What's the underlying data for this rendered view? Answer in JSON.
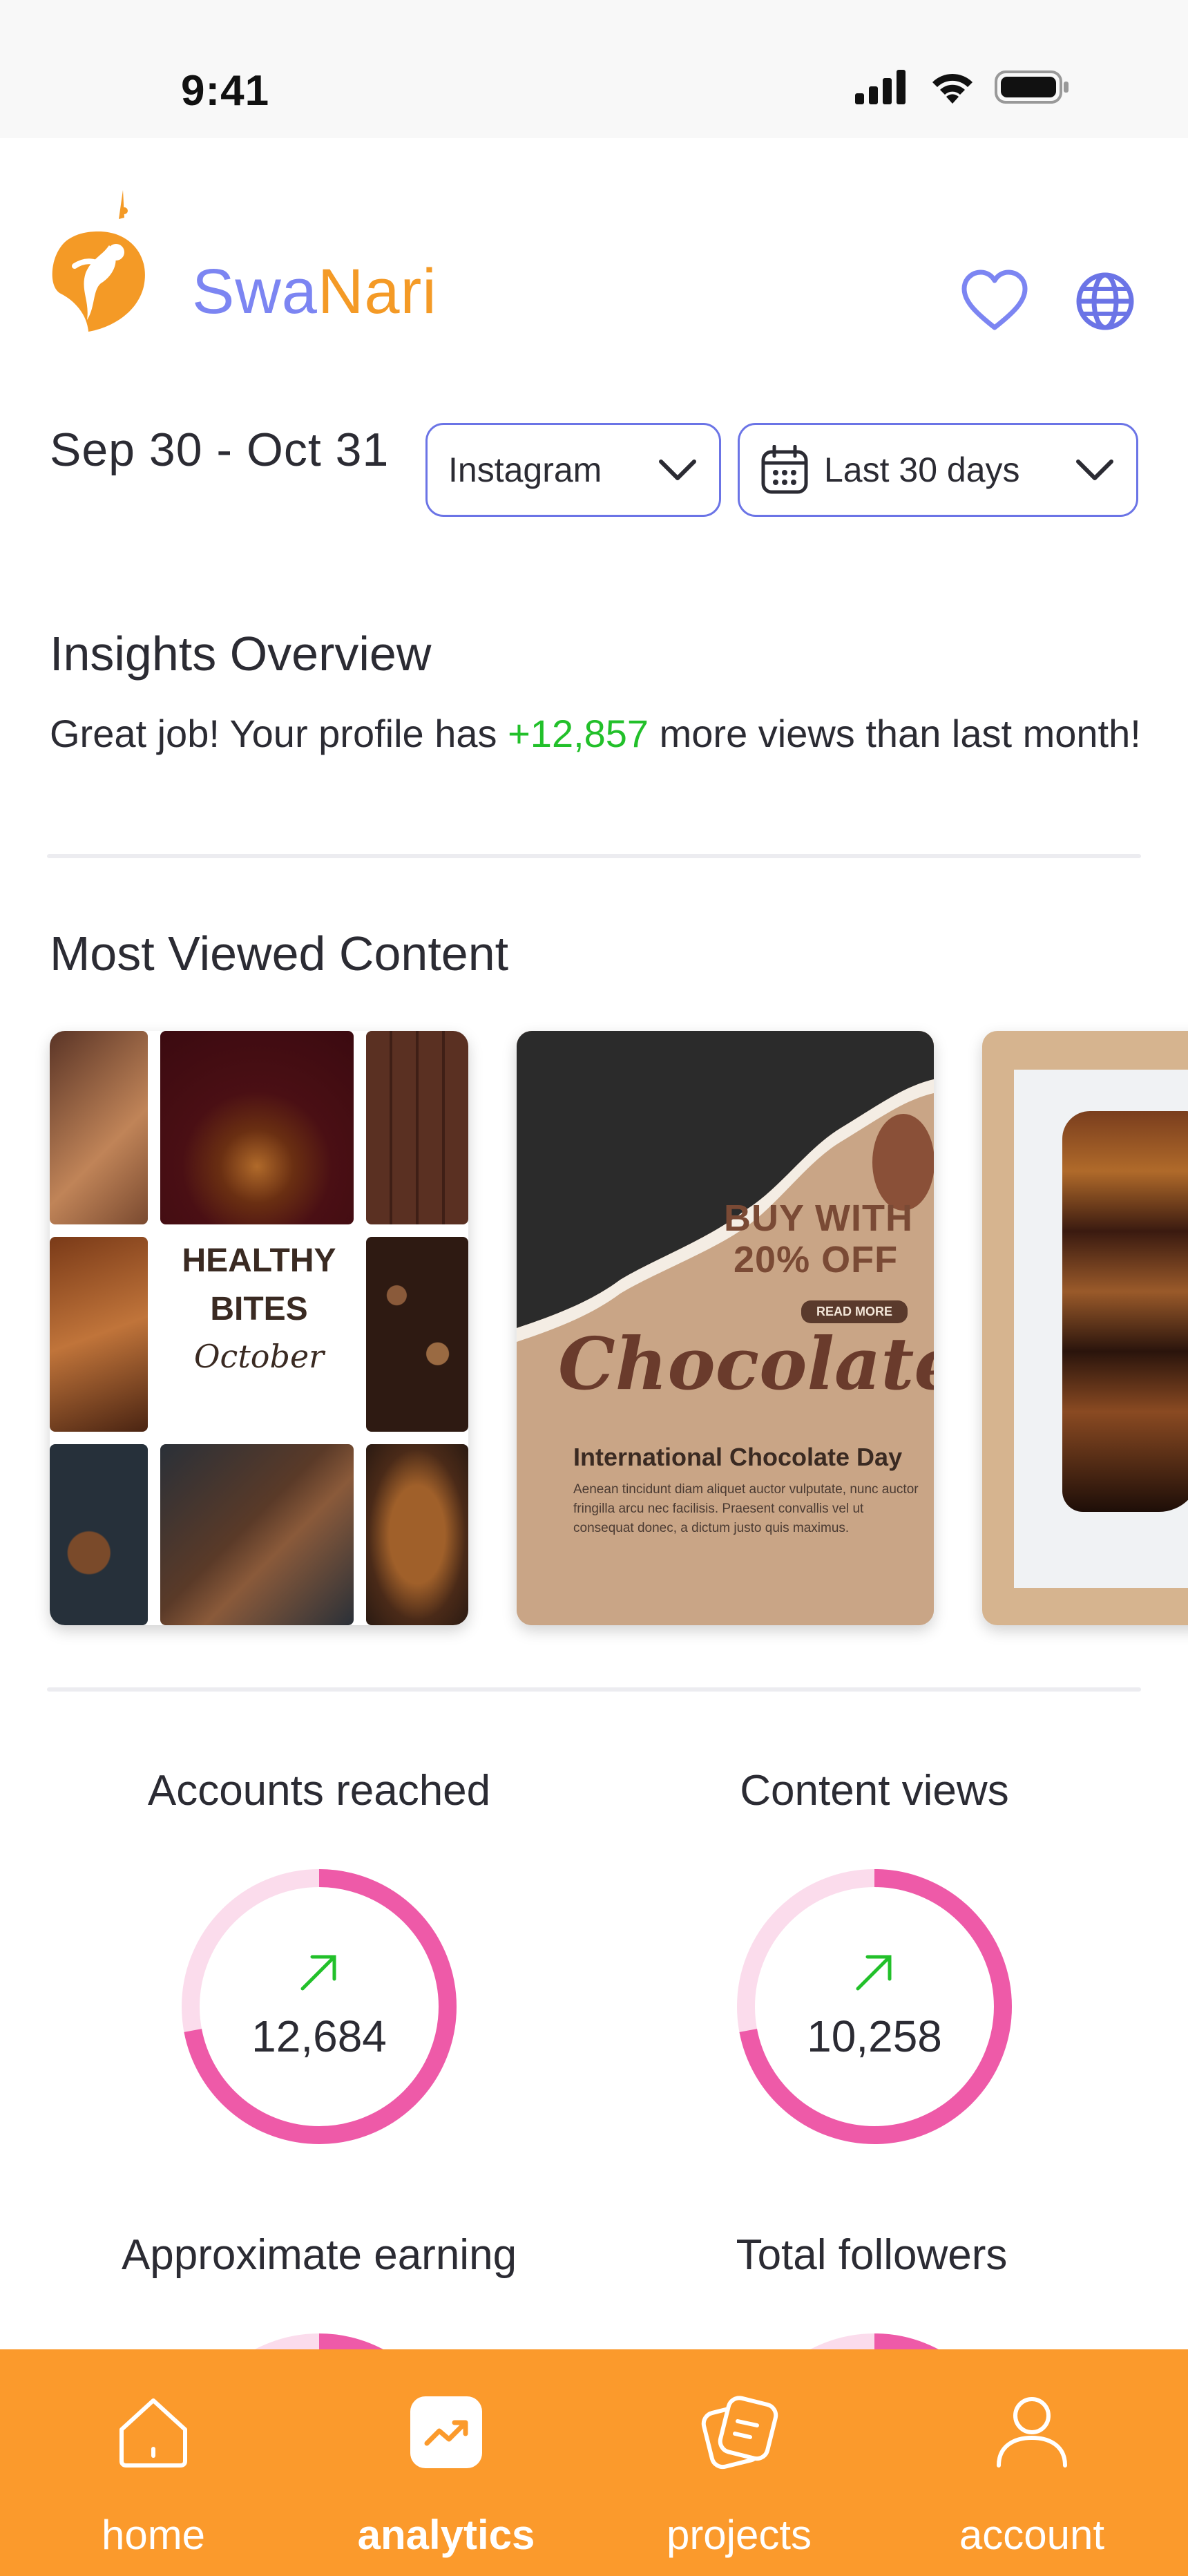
{
  "status_bar": {
    "time": "9:41"
  },
  "brand": {
    "part1": "Swa",
    "part2": "Nari"
  },
  "header": {
    "favorite_icon": "heart-icon",
    "language_icon": "globe-icon"
  },
  "filters": {
    "date_range": "Sep 30 - Oct 31",
    "platform": "Instagram",
    "period": "Last 30 days"
  },
  "insights": {
    "title": "Insights Overview",
    "text_before": "Great job! Your profile has ",
    "delta": "+12,857",
    "text_after": " more views than last month!"
  },
  "most_viewed": {
    "title": "Most Viewed Content",
    "card1": {
      "line1": "HEALTHY",
      "line2": "BITES",
      "sub": "October"
    },
    "card2": {
      "buy": "BUY WITH",
      "off": "20% OFF",
      "read_more": "READ MORE",
      "headline": "Chocolate",
      "day": "International Chocolate Day",
      "body": "Aenean tincidunt diam aliquet auctor vulputate, nunc auctor fringilla arcu nec facilisis. Praesent convallis vel ut consequat donec, a dictum justo quis maximus."
    }
  },
  "stats": [
    {
      "label": "Accounts reached",
      "value": "12,684",
      "trend": "up",
      "progress": 0.72
    },
    {
      "label": "Content views",
      "value": "10,258",
      "trend": "up",
      "progress": 0.72
    },
    {
      "label": "Approximate earning",
      "progress": 0.72
    },
    {
      "label": "Total followers",
      "progress": 0.72
    }
  ],
  "colors": {
    "accent": "#7c85f2",
    "brand_orange": "#f49a26",
    "nav_bg": "#fb9a2c",
    "ring_fill": "#ee5aa8",
    "ring_track": "#fbdcec",
    "positive": "#22c02a"
  },
  "nav": {
    "home": "home",
    "analytics": "analytics",
    "projects": "projects",
    "account": "account",
    "active": "analytics"
  }
}
